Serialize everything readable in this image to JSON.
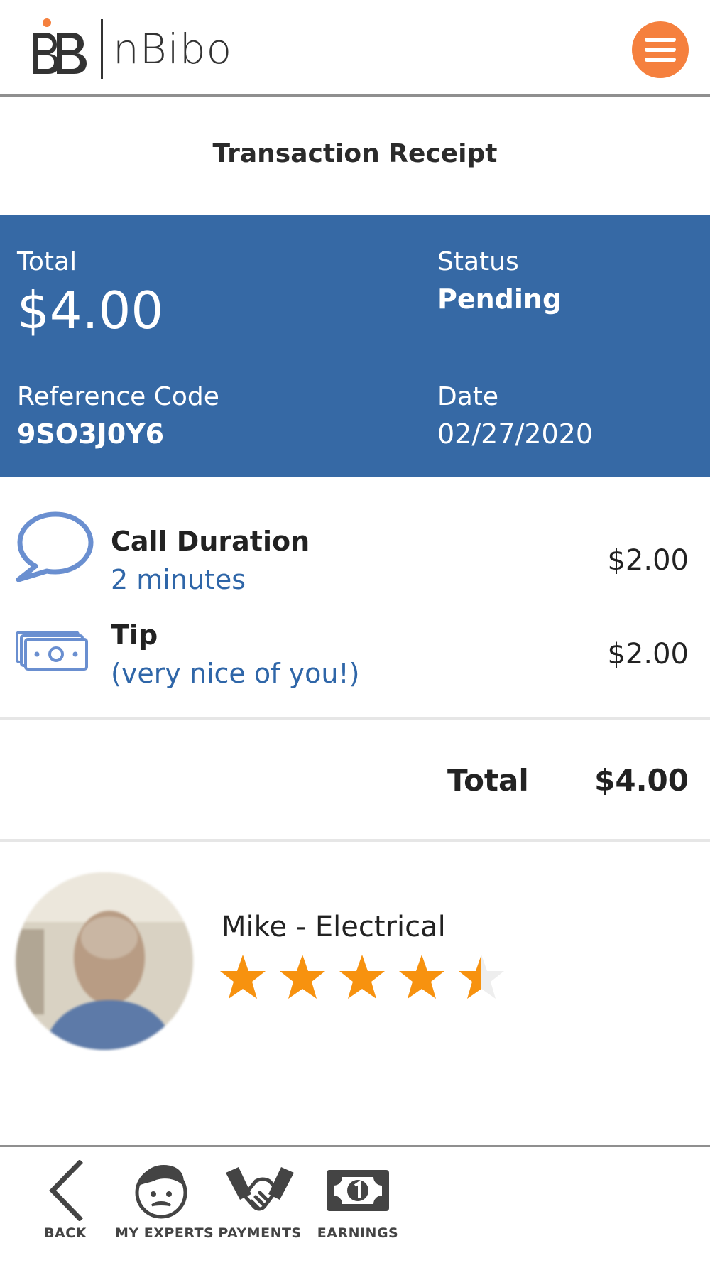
{
  "header": {
    "logo_text": "nBibo",
    "menu_icon": "hamburger-menu-icon",
    "accent_color": "#f5803e"
  },
  "page": {
    "title": "Transaction Receipt"
  },
  "summary": {
    "background_color": "#3669a5",
    "total_label": "Total",
    "total_value": "$4.00",
    "status_label": "Status",
    "status_value": "Pending",
    "reference_label": "Reference Code",
    "reference_value": "9SO3J0Y6",
    "date_label": "Date",
    "date_value": "02/27/2020"
  },
  "line_items": [
    {
      "icon": "speech-bubble-icon",
      "title": "Call Duration",
      "subtitle": "2 minutes",
      "amount": "$2.00"
    },
    {
      "icon": "cash-stack-icon",
      "title": "Tip",
      "subtitle": "(very nice of you!)",
      "amount": "$2.00"
    }
  ],
  "totals": {
    "label": "Total",
    "value": "$4.00"
  },
  "expert": {
    "name": "Mike - Electrical",
    "rating": 4.5,
    "rating_max": 5,
    "star_color": "#f7920f"
  },
  "bottom_nav": {
    "items": [
      {
        "label": "BACK",
        "icon": "chevron-left-icon"
      },
      {
        "label": "MY EXPERTS",
        "icon": "expert-face-icon"
      },
      {
        "label": "PAYMENTS",
        "icon": "handshake-icon"
      },
      {
        "label": "EARNINGS",
        "icon": "banknote-icon"
      }
    ]
  }
}
